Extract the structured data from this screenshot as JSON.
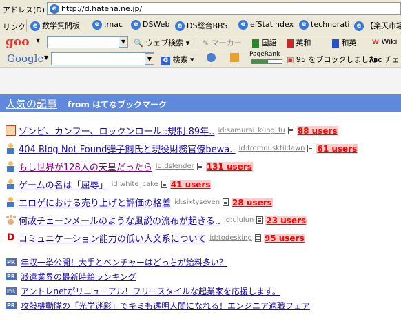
{
  "address_bar": {
    "label": "アドレス(D)",
    "url": "http://d.hatena.ne.jp/"
  },
  "links_bar": {
    "label": "リンク",
    "items": [
      "数学質問板",
      ".mac",
      "DSWeb",
      "DS総合BBS",
      "efStatindex",
      "technorati",
      "【楽天市場"
    ]
  },
  "goo_bar": {
    "logo": "goo",
    "search_label": "ウェブ検索",
    "marker_label": "マーカー",
    "dict_jp": "国語",
    "dict_ej": "英和",
    "dict_je": "和英",
    "wiki_label": "Wiki"
  },
  "google_bar": {
    "logo": "Google",
    "search_label": "検索",
    "pagerank_label": "PageRank",
    "blocked_label": "95 をブロックしました",
    "spell_label": "チェ"
  },
  "section": {
    "title": "人気の記事",
    "subtitle": "from はてなブックマーク"
  },
  "articles": [
    {
      "icon": "zombie-icon",
      "title": "ゾンビ、カンフー、ロックンロール::規制:89年..",
      "id": "id:samurai_kung_fu",
      "users": "88 users",
      "visited": false
    },
    {
      "icon": "user-icon",
      "title": "404 Blog Not Found弾子飼氏と現役財務官僚bewa..",
      "id": "id:fromdusktildawn",
      "users": "61 users",
      "visited": false
    },
    {
      "icon": "user-icon",
      "title": "もし世界が128人の天皇だったら",
      "id": "id:dslender",
      "users": "131 users",
      "visited": true
    },
    {
      "icon": "user-icon",
      "title": "ゲームの名は「屈辱」",
      "id": "id:white_cake",
      "users": "41 users",
      "visited": false
    },
    {
      "icon": "user-icon",
      "title": "エロゲにおける売り上げと評価の格差",
      "id": "id:sixtyseven",
      "users": "28 users",
      "visited": false
    },
    {
      "icon": "paw-icon",
      "title": "何故チェーンメールのような風説の流布が起きる..",
      "id": "id:ululun",
      "users": "23 users",
      "visited": false
    },
    {
      "icon": "d-icon",
      "title": "コミュニケーション能力の低い人文系について",
      "id": "id:todesking",
      "users": "95 users",
      "visited": false
    }
  ],
  "pr_badge": "PR",
  "pr_items": [
    "年収一挙公開！大手とベンチャーはどっちが給料多い？",
    "派遣業界の最新時給ランキング",
    "アントレnetがリニューアル！フリースタイルな起業家を応援します。",
    "攻殻機動隊の「光学迷彩」でキミも透明人間になれる！エンジニア適職フェア"
  ]
}
